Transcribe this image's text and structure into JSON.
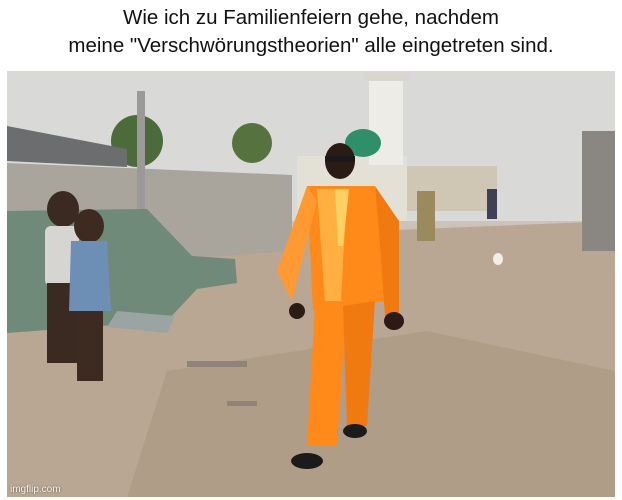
{
  "meme": {
    "caption_line1": "Wie ich zu Familienfeiern gehe, nachdem",
    "caption_line2": "meine \"Verschwörungstheorien\" alle eingetreten sind.",
    "watermark": "imgflip.com"
  },
  "colors": {
    "suit": "#ff8a1a",
    "ground": "#b8a58f",
    "sky": "#d8d8d6",
    "wall": "#a8a39b"
  }
}
